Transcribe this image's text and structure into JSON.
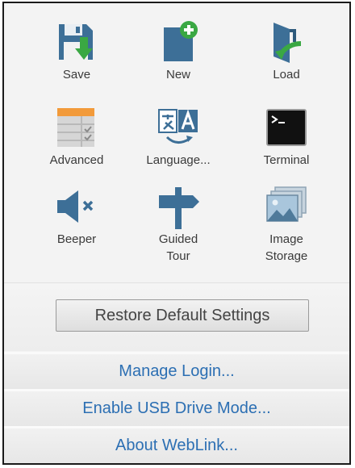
{
  "tiles": [
    {
      "label": "Save",
      "icon": "save-icon"
    },
    {
      "label": "New",
      "icon": "new-file-icon"
    },
    {
      "label": "Load",
      "icon": "load-icon"
    },
    {
      "label": "Advanced",
      "icon": "advanced-icon"
    },
    {
      "label": "Language...",
      "icon": "language-icon"
    },
    {
      "label": "Terminal",
      "icon": "terminal-icon"
    },
    {
      "label": "Beeper",
      "icon": "beeper-icon"
    },
    {
      "label": "Guided\nTour",
      "icon": "guided-tour-icon"
    },
    {
      "label": "Image\nStorage",
      "icon": "image-storage-icon"
    }
  ],
  "restore_button": {
    "label": "Restore Default Settings"
  },
  "links": [
    {
      "label": "Manage Login..."
    },
    {
      "label": "Enable USB Drive Mode..."
    },
    {
      "label": "About WebLink..."
    }
  ],
  "colors": {
    "accent_blue": "#3d6f97",
    "accent_green": "#3aa843",
    "link_blue": "#2c6fb3"
  }
}
